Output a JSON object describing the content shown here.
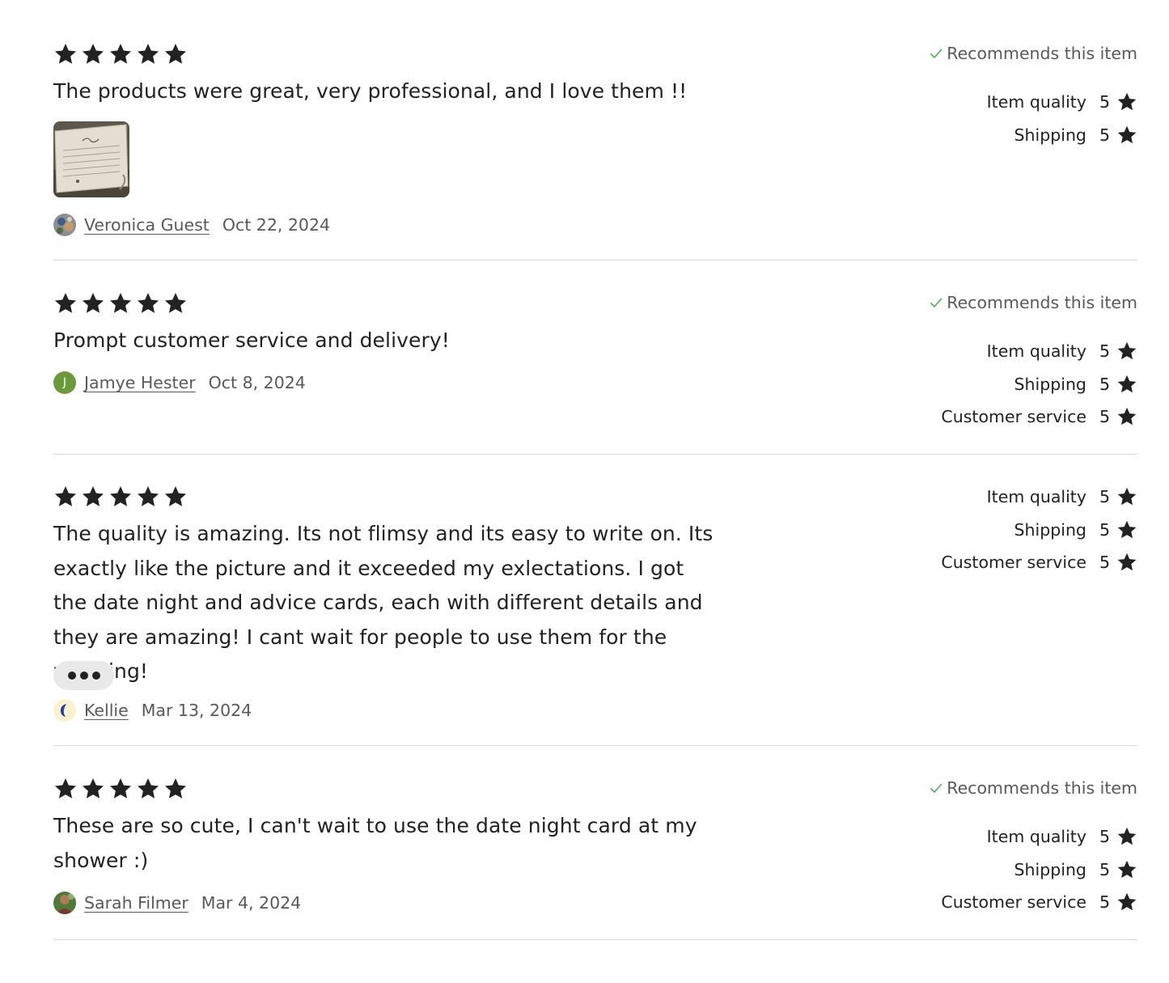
{
  "reviews": [
    {
      "rating": 5,
      "text": "The products were great, very professional, and I love them !!",
      "has_photo": true,
      "author": "Veronica Guest",
      "date": "Oct 22, 2024",
      "recommends": "Recommends this item",
      "ratings": [
        {
          "label": "Item quality",
          "value": "5"
        },
        {
          "label": "Shipping",
          "value": "5"
        }
      ]
    },
    {
      "rating": 5,
      "text": "Prompt customer service and delivery!",
      "author_initial": "J",
      "author": "Jamye Hester",
      "date": "Oct 8, 2024",
      "recommends": "Recommends this item",
      "ratings": [
        {
          "label": "Item quality",
          "value": "5"
        },
        {
          "label": "Shipping",
          "value": "5"
        },
        {
          "label": "Customer service",
          "value": "5"
        }
      ]
    },
    {
      "rating": 5,
      "text": "The quality is amazing. Its not flimsy and its easy to write on. Its exactly like the picture and it exceeded my exlectations. I got the date night and advice cards, each with different details and they are amazing! I cant wait for people to use them for the wedding!",
      "has_more_button": true,
      "author": "Kellie",
      "date": "Mar 13, 2024",
      "ratings": [
        {
          "label": "Item quality",
          "value": "5"
        },
        {
          "label": "Shipping",
          "value": "5"
        },
        {
          "label": "Customer service",
          "value": "5"
        }
      ]
    },
    {
      "rating": 5,
      "text": "These are so cute, I can't wait to use the date night card at my shower :)",
      "author": "Sarah Filmer",
      "date": "Mar 4, 2024",
      "recommends": "Recommends this item",
      "ratings": [
        {
          "label": "Item quality",
          "value": "5"
        },
        {
          "label": "Shipping",
          "value": "5"
        },
        {
          "label": "Customer service",
          "value": "5"
        }
      ]
    }
  ],
  "colors": {
    "text": "#222222",
    "muted": "#595959",
    "check": "#4caf50",
    "divider": "#d6d6d6",
    "avatar_green": "#6a9a3a"
  },
  "icons": {
    "star": "star-icon",
    "check": "check-icon",
    "more": "more-dots-icon"
  }
}
